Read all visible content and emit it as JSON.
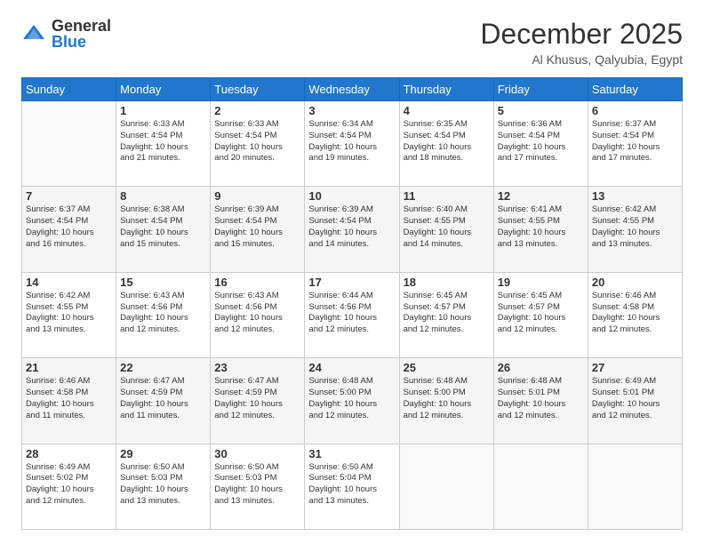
{
  "logo": {
    "general": "General",
    "blue": "Blue"
  },
  "header": {
    "month": "December 2025",
    "location": "Al Khusus, Qalyubia, Egypt"
  },
  "days_header": [
    "Sunday",
    "Monday",
    "Tuesday",
    "Wednesday",
    "Thursday",
    "Friday",
    "Saturday"
  ],
  "weeks": [
    [
      {
        "day": "",
        "info": ""
      },
      {
        "day": "1",
        "info": "Sunrise: 6:33 AM\nSunset: 4:54 PM\nDaylight: 10 hours\nand 21 minutes."
      },
      {
        "day": "2",
        "info": "Sunrise: 6:33 AM\nSunset: 4:54 PM\nDaylight: 10 hours\nand 20 minutes."
      },
      {
        "day": "3",
        "info": "Sunrise: 6:34 AM\nSunset: 4:54 PM\nDaylight: 10 hours\nand 19 minutes."
      },
      {
        "day": "4",
        "info": "Sunrise: 6:35 AM\nSunset: 4:54 PM\nDaylight: 10 hours\nand 18 minutes."
      },
      {
        "day": "5",
        "info": "Sunrise: 6:36 AM\nSunset: 4:54 PM\nDaylight: 10 hours\nand 17 minutes."
      },
      {
        "day": "6",
        "info": "Sunrise: 6:37 AM\nSunset: 4:54 PM\nDaylight: 10 hours\nand 17 minutes."
      }
    ],
    [
      {
        "day": "7",
        "info": "Sunrise: 6:37 AM\nSunset: 4:54 PM\nDaylight: 10 hours\nand 16 minutes."
      },
      {
        "day": "8",
        "info": "Sunrise: 6:38 AM\nSunset: 4:54 PM\nDaylight: 10 hours\nand 15 minutes."
      },
      {
        "day": "9",
        "info": "Sunrise: 6:39 AM\nSunset: 4:54 PM\nDaylight: 10 hours\nand 15 minutes."
      },
      {
        "day": "10",
        "info": "Sunrise: 6:39 AM\nSunset: 4:54 PM\nDaylight: 10 hours\nand 14 minutes."
      },
      {
        "day": "11",
        "info": "Sunrise: 6:40 AM\nSunset: 4:55 PM\nDaylight: 10 hours\nand 14 minutes."
      },
      {
        "day": "12",
        "info": "Sunrise: 6:41 AM\nSunset: 4:55 PM\nDaylight: 10 hours\nand 13 minutes."
      },
      {
        "day": "13",
        "info": "Sunrise: 6:42 AM\nSunset: 4:55 PM\nDaylight: 10 hours\nand 13 minutes."
      }
    ],
    [
      {
        "day": "14",
        "info": "Sunrise: 6:42 AM\nSunset: 4:55 PM\nDaylight: 10 hours\nand 13 minutes."
      },
      {
        "day": "15",
        "info": "Sunrise: 6:43 AM\nSunset: 4:56 PM\nDaylight: 10 hours\nand 12 minutes."
      },
      {
        "day": "16",
        "info": "Sunrise: 6:43 AM\nSunset: 4:56 PM\nDaylight: 10 hours\nand 12 minutes."
      },
      {
        "day": "17",
        "info": "Sunrise: 6:44 AM\nSunset: 4:56 PM\nDaylight: 10 hours\nand 12 minutes."
      },
      {
        "day": "18",
        "info": "Sunrise: 6:45 AM\nSunset: 4:57 PM\nDaylight: 10 hours\nand 12 minutes."
      },
      {
        "day": "19",
        "info": "Sunrise: 6:45 AM\nSunset: 4:57 PM\nDaylight: 10 hours\nand 12 minutes."
      },
      {
        "day": "20",
        "info": "Sunrise: 6:46 AM\nSunset: 4:58 PM\nDaylight: 10 hours\nand 12 minutes."
      }
    ],
    [
      {
        "day": "21",
        "info": "Sunrise: 6:46 AM\nSunset: 4:58 PM\nDaylight: 10 hours\nand 11 minutes."
      },
      {
        "day": "22",
        "info": "Sunrise: 6:47 AM\nSunset: 4:59 PM\nDaylight: 10 hours\nand 11 minutes."
      },
      {
        "day": "23",
        "info": "Sunrise: 6:47 AM\nSunset: 4:59 PM\nDaylight: 10 hours\nand 12 minutes."
      },
      {
        "day": "24",
        "info": "Sunrise: 6:48 AM\nSunset: 5:00 PM\nDaylight: 10 hours\nand 12 minutes."
      },
      {
        "day": "25",
        "info": "Sunrise: 6:48 AM\nSunset: 5:00 PM\nDaylight: 10 hours\nand 12 minutes."
      },
      {
        "day": "26",
        "info": "Sunrise: 6:48 AM\nSunset: 5:01 PM\nDaylight: 10 hours\nand 12 minutes."
      },
      {
        "day": "27",
        "info": "Sunrise: 6:49 AM\nSunset: 5:01 PM\nDaylight: 10 hours\nand 12 minutes."
      }
    ],
    [
      {
        "day": "28",
        "info": "Sunrise: 6:49 AM\nSunset: 5:02 PM\nDaylight: 10 hours\nand 12 minutes."
      },
      {
        "day": "29",
        "info": "Sunrise: 6:50 AM\nSunset: 5:03 PM\nDaylight: 10 hours\nand 13 minutes."
      },
      {
        "day": "30",
        "info": "Sunrise: 6:50 AM\nSunset: 5:03 PM\nDaylight: 10 hours\nand 13 minutes."
      },
      {
        "day": "31",
        "info": "Sunrise: 6:50 AM\nSunset: 5:04 PM\nDaylight: 10 hours\nand 13 minutes."
      },
      {
        "day": "",
        "info": ""
      },
      {
        "day": "",
        "info": ""
      },
      {
        "day": "",
        "info": ""
      }
    ]
  ]
}
